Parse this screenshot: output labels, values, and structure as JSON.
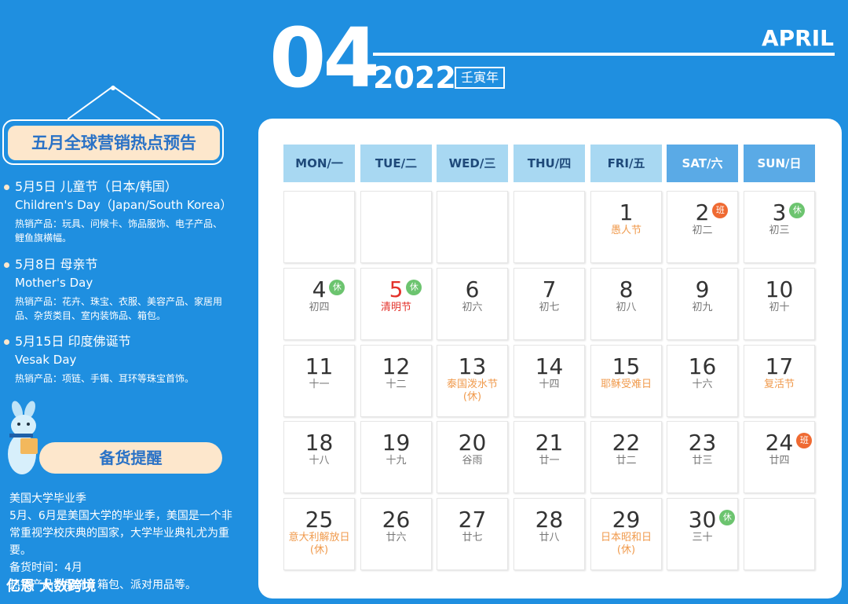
{
  "header": {
    "month_num": "04",
    "month_en": "APRIL",
    "year": "2022",
    "ganzhi": "壬寅年"
  },
  "promo": {
    "title": "五月全球营销热点预告",
    "events": [
      {
        "head": "5月5日 儿童节（日本/韩国）",
        "en": "Children's Day（Japan/South Korea）",
        "products": "热销产品：玩具、问候卡、饰品服饰、电子产品、鲤鱼旗横幅。"
      },
      {
        "head": "5月8日 母亲节",
        "en": "Mother's Day",
        "products": "热销产品：花卉、珠宝、衣服、美容产品、家居用品、杂货类目、室内装饰品、箱包。"
      },
      {
        "head": "5月15日 印度佛诞节",
        "en": "Vesak Day",
        "products": "热销产品：项链、手镯、耳环等珠宝首饰。"
      }
    ]
  },
  "stock": {
    "banner": "备货提醒",
    "heading": "美国大学毕业季",
    "body": "5月、6月是美国大学的毕业季，美国是一个非常重视学校庆典的国家，大学毕业典礼尤为重要。",
    "time": "备货时间：4月",
    "products": "热销产品：服饰、箱包、派对用品等。"
  },
  "brand": "亿恩 大数跨境",
  "weekdays": [
    "MON/一",
    "TUE/二",
    "WED/三",
    "THU/四",
    "FRI/五",
    "SAT/六",
    "SUN/日"
  ],
  "days": [
    {
      "n": "1",
      "sub": "愚人节",
      "sub_color": "orange"
    },
    {
      "n": "2",
      "sub": "初二",
      "badge": "班"
    },
    {
      "n": "3",
      "sub": "初三",
      "badge": "休"
    },
    {
      "n": "4",
      "sub": "初四",
      "badge": "休"
    },
    {
      "n": "5",
      "sub": "清明节",
      "sub_color": "red",
      "num_color": "red",
      "badge": "休"
    },
    {
      "n": "6",
      "sub": "初六"
    },
    {
      "n": "7",
      "sub": "初七"
    },
    {
      "n": "8",
      "sub": "初八"
    },
    {
      "n": "9",
      "sub": "初九"
    },
    {
      "n": "10",
      "sub": "初十"
    },
    {
      "n": "11",
      "sub": "十一"
    },
    {
      "n": "12",
      "sub": "十二"
    },
    {
      "n": "13",
      "sub": "泰国泼水节",
      "sub2": "(休)",
      "sub_color": "orange"
    },
    {
      "n": "14",
      "sub": "十四"
    },
    {
      "n": "15",
      "sub": "耶稣受难日",
      "sub_color": "orange"
    },
    {
      "n": "16",
      "sub": "十六"
    },
    {
      "n": "17",
      "sub": "复活节",
      "sub_color": "orange"
    },
    {
      "n": "18",
      "sub": "十八"
    },
    {
      "n": "19",
      "sub": "十九"
    },
    {
      "n": "20",
      "sub": "谷雨"
    },
    {
      "n": "21",
      "sub": "廿一"
    },
    {
      "n": "22",
      "sub": "廿二"
    },
    {
      "n": "23",
      "sub": "廿三"
    },
    {
      "n": "24",
      "sub": "廿四",
      "badge": "班"
    },
    {
      "n": "25",
      "sub": "意大利解放日",
      "sub2": "(休)",
      "sub_color": "orange"
    },
    {
      "n": "26",
      "sub": "廿六"
    },
    {
      "n": "27",
      "sub": "廿七"
    },
    {
      "n": "28",
      "sub": "廿八"
    },
    {
      "n": "29",
      "sub": "日本昭和日",
      "sub2": "(休)",
      "sub_color": "orange"
    },
    {
      "n": "30",
      "sub": "三十",
      "badge": "休"
    }
  ]
}
